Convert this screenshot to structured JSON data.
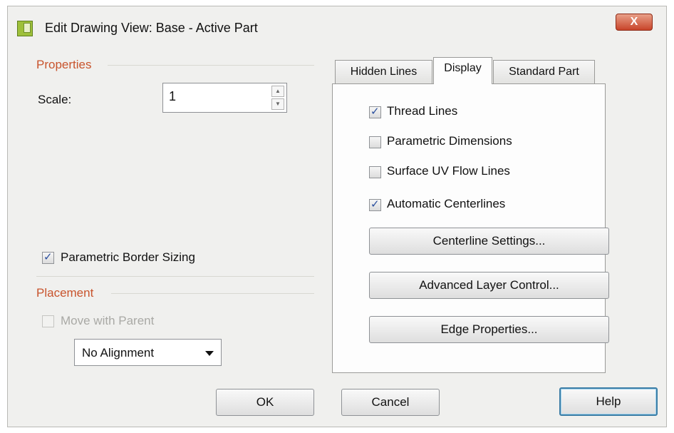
{
  "window": {
    "title": "Edit Drawing View: Base - Active Part",
    "close_glyph": "X"
  },
  "properties": {
    "section_label": "Properties",
    "scale_label": "Scale:",
    "scale_value": "1",
    "parametric_border_sizing": {
      "label": "Parametric Border Sizing",
      "checked": true
    }
  },
  "placement": {
    "section_label": "Placement",
    "move_with_parent": {
      "label": "Move with Parent",
      "checked": false,
      "enabled": false
    },
    "alignment": {
      "selected": "No Alignment"
    }
  },
  "tabs": [
    {
      "label": "Hidden Lines",
      "active": false
    },
    {
      "label": "Display",
      "active": true
    },
    {
      "label": "Standard Part",
      "active": false
    }
  ],
  "display": {
    "checkboxes": [
      {
        "label": "Thread Lines",
        "checked": true
      },
      {
        "label": "Parametric Dimensions",
        "checked": false
      },
      {
        "label": "Surface UV Flow Lines",
        "checked": false
      },
      {
        "label": "Automatic Centerlines",
        "checked": true
      }
    ],
    "buttons": [
      "Centerline Settings...",
      "Advanced Layer Control...",
      "Edge Properties..."
    ]
  },
  "footer": {
    "ok": "OK",
    "cancel": "Cancel",
    "help": "Help"
  },
  "colors": {
    "section_label": "#c8542d",
    "checkmark": "#2a4f9e",
    "close_button": "#c8442a"
  },
  "icons": {
    "app": "drawing-view-icon",
    "close": "close-icon",
    "dropdown": "chevron-down-icon",
    "spinner": "spinner-arrows-icon",
    "check": "checkmark-icon"
  }
}
